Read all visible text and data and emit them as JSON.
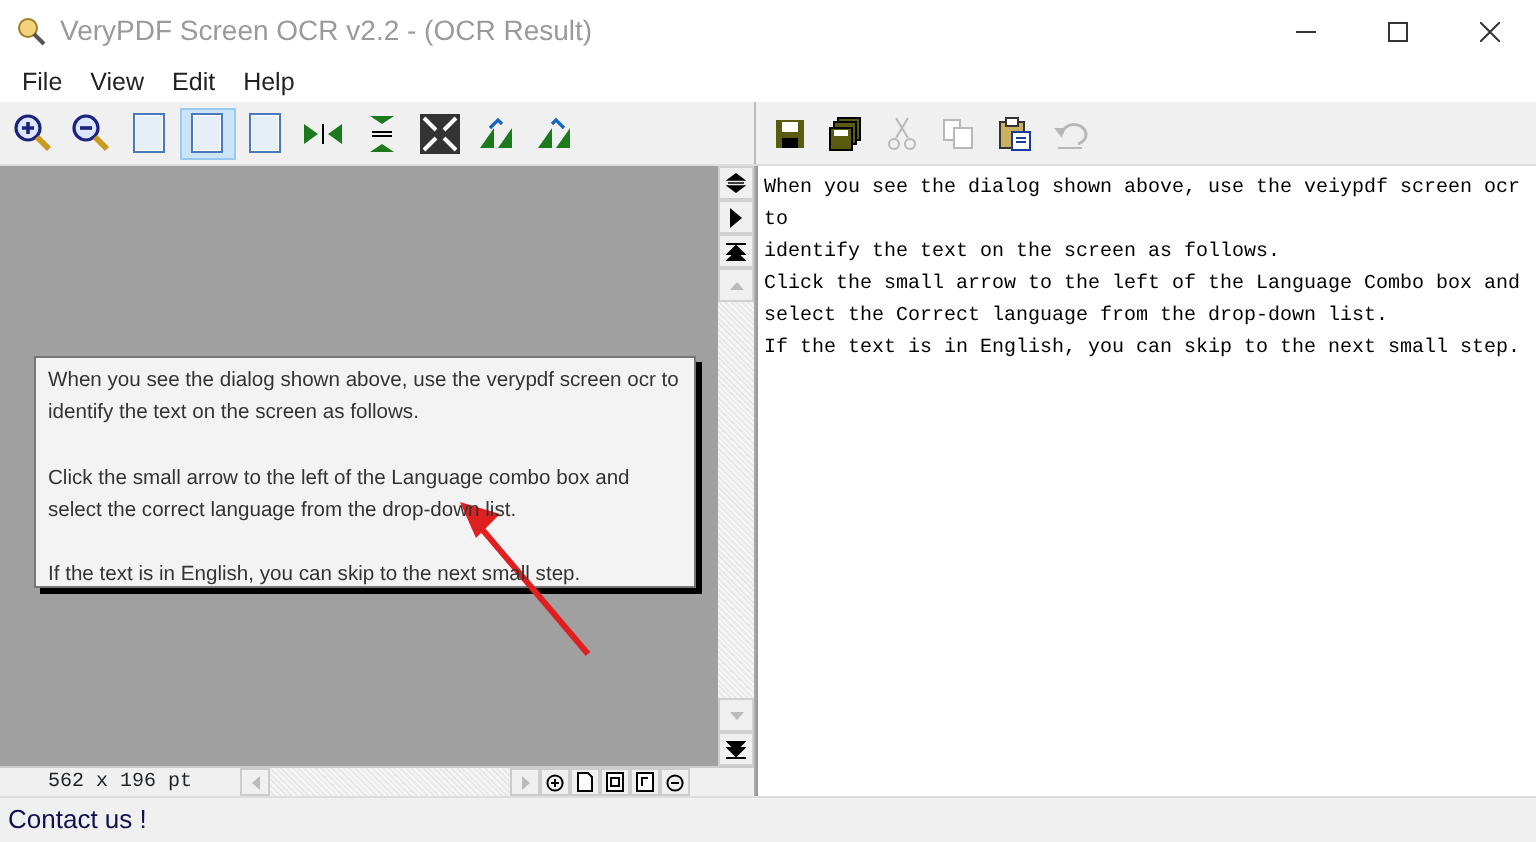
{
  "window": {
    "title": "VeryPDF Screen OCR v2.2 - (OCR Result)"
  },
  "menu": [
    "File",
    "View",
    "Edit",
    "Help"
  ],
  "image_toolbar": [
    {
      "kind": "zoom-in",
      "selected": false
    },
    {
      "kind": "zoom-out",
      "selected": false
    },
    {
      "kind": "page",
      "selected": false
    },
    {
      "kind": "page",
      "selected": true
    },
    {
      "kind": "page",
      "selected": false
    },
    {
      "kind": "fit-width",
      "selected": false
    },
    {
      "kind": "fit-height",
      "selected": false
    },
    {
      "kind": "fit-all",
      "selected": false
    },
    {
      "kind": "rotate-left",
      "selected": false
    },
    {
      "kind": "rotate-right",
      "selected": false
    }
  ],
  "text_toolbar": [
    {
      "kind": "save",
      "disabled": false
    },
    {
      "kind": "save-all",
      "disabled": false
    },
    {
      "kind": "cut",
      "disabled": true
    },
    {
      "kind": "copy",
      "disabled": true
    },
    {
      "kind": "paste",
      "disabled": false
    },
    {
      "kind": "undo",
      "disabled": true
    }
  ],
  "captured_image": {
    "paragraphs": [
      [
        "When you see the dialog shown above, use the verypdf screen ocr to",
        "identify the text on the screen as follows."
      ],
      [
        "Click the small arrow to the left of the Language combo box and",
        "select the correct language from the drop-down list."
      ],
      [
        "If the text is in English, you can skip to the next small step."
      ]
    ]
  },
  "image_size": "562 x 196 pt",
  "ocr_result": {
    "lines": [
      "When you see the dialog shown above, use the veiypdf screen ocr",
      "to",
      "identify the text on the screen as follows.",
      "Click the small arrow to the left of the Language Combo box and",
      "select the Correct language from the drop-down list.",
      "If the text is in English, you can skip to the next small step."
    ]
  },
  "status_bar": "Contact us !"
}
